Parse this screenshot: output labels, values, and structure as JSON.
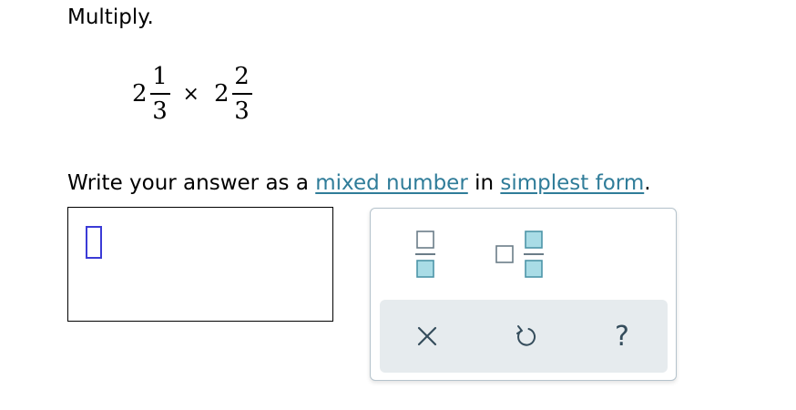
{
  "prompt": "Multiply.",
  "expression": {
    "left": {
      "whole": "2",
      "numerator": "1",
      "denominator": "3"
    },
    "operator": "×",
    "right": {
      "whole": "2",
      "numerator": "2",
      "denominator": "3"
    }
  },
  "instruction": {
    "prefix": "Write your answer as a ",
    "link1": "mixed number",
    "middle": " in ",
    "link2": "simplest form",
    "suffix": "."
  },
  "keypad": {
    "keys": [
      "fraction-icon",
      "mixed-number-icon",
      "clear-icon",
      "undo-icon",
      "help-icon"
    ],
    "help_label": "?"
  },
  "colors": {
    "link": "#2f7c99",
    "cursor": "#3b3bd6",
    "keypad_icon": "#354d5c",
    "tray": "#e6ebee",
    "box_fill": "#a9dce6"
  }
}
